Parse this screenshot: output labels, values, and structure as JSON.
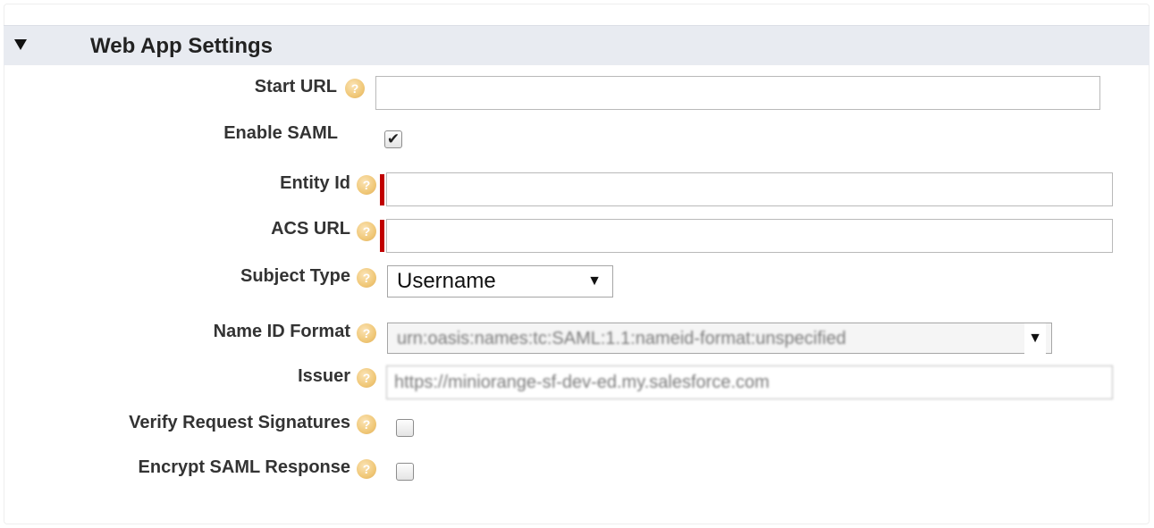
{
  "section": {
    "title": "Web App Settings"
  },
  "fields": {
    "start_url": {
      "label": "Start URL",
      "value": ""
    },
    "enable_saml": {
      "label": "Enable SAML",
      "checked": true,
      "check_glyph": "✔"
    },
    "entity_id": {
      "label": "Entity Id",
      "value": ""
    },
    "acs_url": {
      "label": "ACS URL",
      "value": ""
    },
    "subject_type": {
      "label": "Subject Type",
      "selected": "Username"
    },
    "name_id_format": {
      "label": "Name ID Format",
      "selected": "urn:oasis:names:tc:SAML:1.1:nameid-format:unspecified"
    },
    "issuer": {
      "label": "Issuer",
      "value": "https://miniorange-sf-dev-ed.my.salesforce.com"
    },
    "verify_request_signatures": {
      "label": "Verify Request Signatures",
      "checked": false
    },
    "encrypt_saml_response": {
      "label": "Encrypt SAML Response",
      "checked": false
    }
  },
  "icons": {
    "help": "question-circle-icon",
    "collapse": "triangle-down-icon",
    "dropdown": "triangle-down-icon"
  },
  "colors": {
    "header_bg": "#e8ebf1",
    "required": "#c00000",
    "help_icon": "#f0c878"
  }
}
